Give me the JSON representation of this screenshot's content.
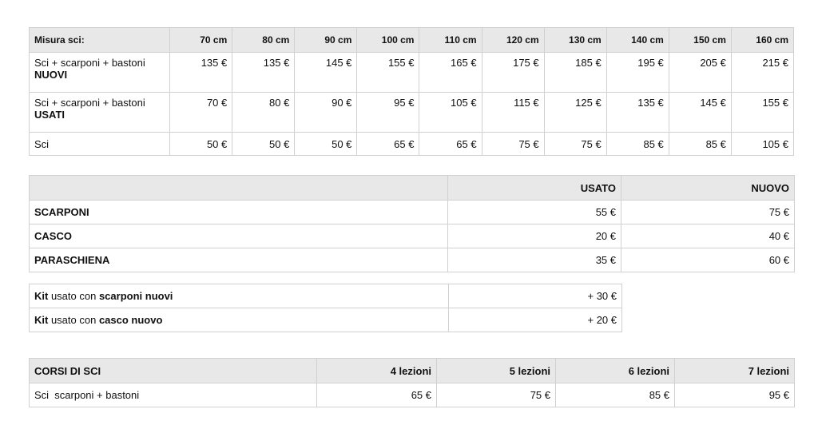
{
  "ski_table": {
    "header_label": "Misura sci:",
    "sizes": [
      "70 cm",
      "80 cm",
      "90 cm",
      "100 cm",
      "110 cm",
      "120 cm",
      "130 cm",
      "140 cm",
      "150 cm",
      "160 cm"
    ],
    "rows": [
      {
        "label_main": "Sci + scarponi + bastoni",
        "label_bold": "NUOVI",
        "values": [
          "135 €",
          "135 €",
          "145 €",
          "155 €",
          "165 €",
          "175 €",
          "185 €",
          "195 €",
          "205 €",
          "215 €"
        ]
      },
      {
        "label_main": "Sci + scarponi + bastoni",
        "label_bold": "USATI",
        "values": [
          "70 €",
          "80 €",
          "90 €",
          "95 €",
          "105 €",
          "115 €",
          "125 €",
          "135 €",
          "145 €",
          "155 €"
        ]
      },
      {
        "label_main": "Sci",
        "label_bold": "",
        "values": [
          "50 €",
          "50 €",
          "50 €",
          "65 €",
          "65 €",
          "75 €",
          "75 €",
          "85 €",
          "85 €",
          "105 €"
        ]
      }
    ]
  },
  "equipment_table": {
    "col_used": "USATO",
    "col_new": "NUOVO",
    "rows": [
      {
        "label": "SCARPONI",
        "used": "55 €",
        "new": "75 €"
      },
      {
        "label": "CASCO",
        "used": "20 €",
        "new": "40 €"
      },
      {
        "label": "PARASCHIENA",
        "used": "35 €",
        "new": "60 €"
      }
    ]
  },
  "kit_table": {
    "rows": [
      {
        "bold1": "Kit",
        "mid": " usato con ",
        "bold2": "scarponi nuovi",
        "price": "+ 30 €"
      },
      {
        "bold1": "Kit",
        "mid": " usato con ",
        "bold2": "casco nuovo",
        "price": "+ 20 €"
      }
    ]
  },
  "courses_table": {
    "title": "CORSI DI SCI",
    "columns": [
      "4 lezioni",
      "5 lezioni",
      "6 lezioni",
      "7 lezioni"
    ],
    "row_label": "Sci  scarponi + bastoni",
    "values": [
      "65 €",
      "75 €",
      "85 €",
      "95 €"
    ]
  }
}
